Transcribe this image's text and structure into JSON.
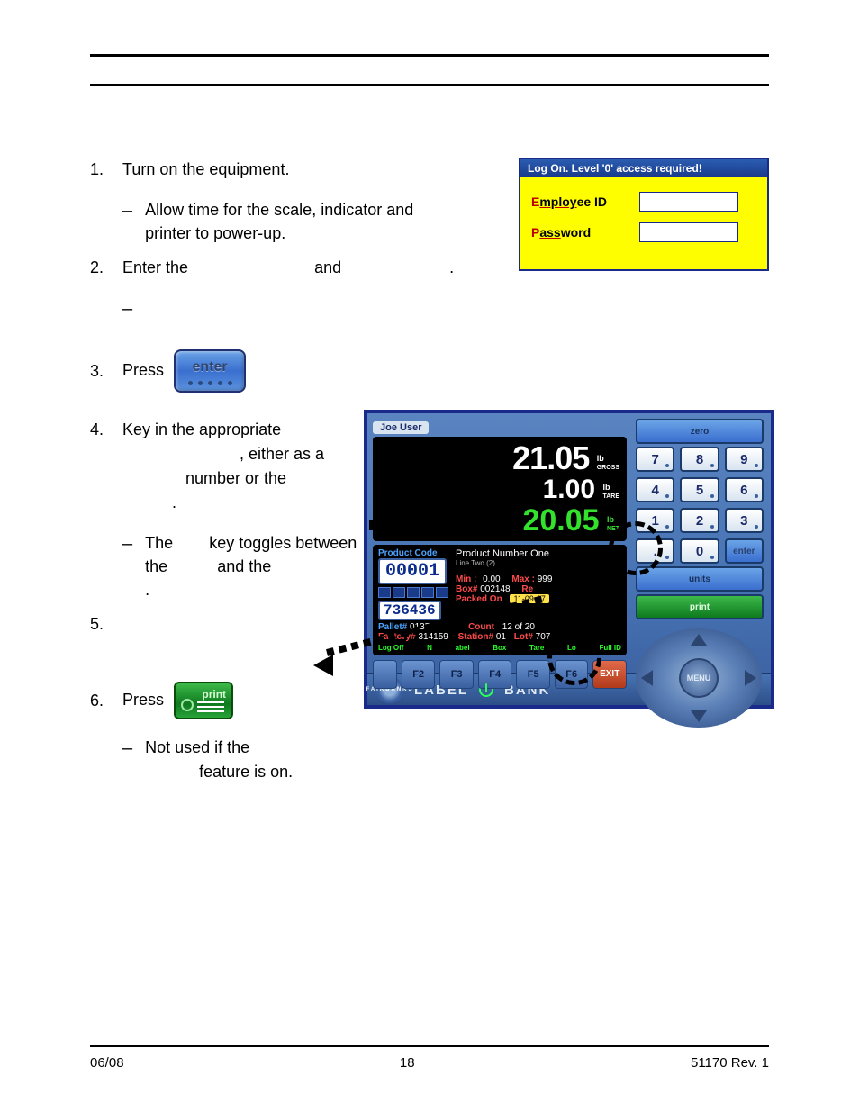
{
  "footer": {
    "left": "06/08",
    "center": "18",
    "right": "51170    Rev. 1"
  },
  "login": {
    "title": "Log On. Level '0' access required!",
    "emp_label": "Employee ID",
    "emp_key": "E",
    "pwd_label": "Password",
    "pwd_key": "P"
  },
  "steps": {
    "s1": {
      "num": "1.",
      "text": "Turn on the equipment.",
      "sub": "Allow time for the scale, indicator and printer to power-up."
    },
    "s2": {
      "num": "2.",
      "a": "Enter the",
      "b": "and",
      "c": "."
    },
    "s3": {
      "num": "3.",
      "text": "Press"
    },
    "s4": {
      "num": "4.",
      "a": "Key in the appropriate",
      "b": ", either as a",
      "c": "number or the",
      "d": ".",
      "sub_a": "The",
      "sub_b": "key toggles between the",
      "sub_c": "and the",
      "sub_d": "."
    },
    "s5": {
      "num": "5."
    },
    "s6": {
      "num": "6.",
      "text": "Press",
      "sub_a": "Not used if the",
      "sub_b": "feature is on."
    }
  },
  "btn_enter": "enter",
  "btn_print": "print",
  "device": {
    "user": "Joe User",
    "weight_gross": "21.05",
    "unit_gross_a": "lb",
    "unit_gross_b": "GROSS",
    "weight_tare": "1.00",
    "unit_tare_a": "lb",
    "unit_tare_b": "TARE",
    "weight_net": "20.05",
    "unit_net_a": "lb",
    "unit_net_b": "NET",
    "prod_code_lbl": "Product Code",
    "prod_code": "00001",
    "prod_name": "Product Number One",
    "line_two": "Line Two (2)",
    "min_lbl": "Min :",
    "min_val": "0.00",
    "max_lbl": "Max :",
    "max_val": "999",
    "lot_code": "736436",
    "box_lbl": "Box#",
    "box_val": "002148",
    "re_lbl": "Re",
    "packed_lbl": "Packed On",
    "packed_val": "11-09-07",
    "pallet_lbl": "Pallet#",
    "pallet_val": "0135",
    "count_lbl": "Count",
    "count_val": "12 of 20",
    "factory_lbl": "Factory#",
    "factory_val": "314159",
    "station_lbl": "Station#",
    "station_val": "01",
    "lot_lbl": "Lot#",
    "lot_val": "707",
    "bar_labels": [
      "Log Off",
      "N",
      "abel",
      "Box",
      "Tare",
      "Lo",
      "Full ID"
    ],
    "softkeys": [
      "F2",
      "F3",
      "F4",
      "F5",
      "F6"
    ],
    "exit": "EXIT",
    "zero_btn": "zero",
    "units_btn": "units",
    "print_btn": "print",
    "menu": "MENU",
    "keypad": [
      [
        "7",
        "8",
        "9"
      ],
      [
        "4",
        "5",
        "6"
      ],
      [
        "1",
        "2",
        "3"
      ],
      [
        ".",
        "0",
        "enter"
      ]
    ],
    "enter_key": "enter",
    "logo_a": "FAIRBANKS",
    "logo_b1": "LABEL",
    "logo_b2": "BANK"
  }
}
